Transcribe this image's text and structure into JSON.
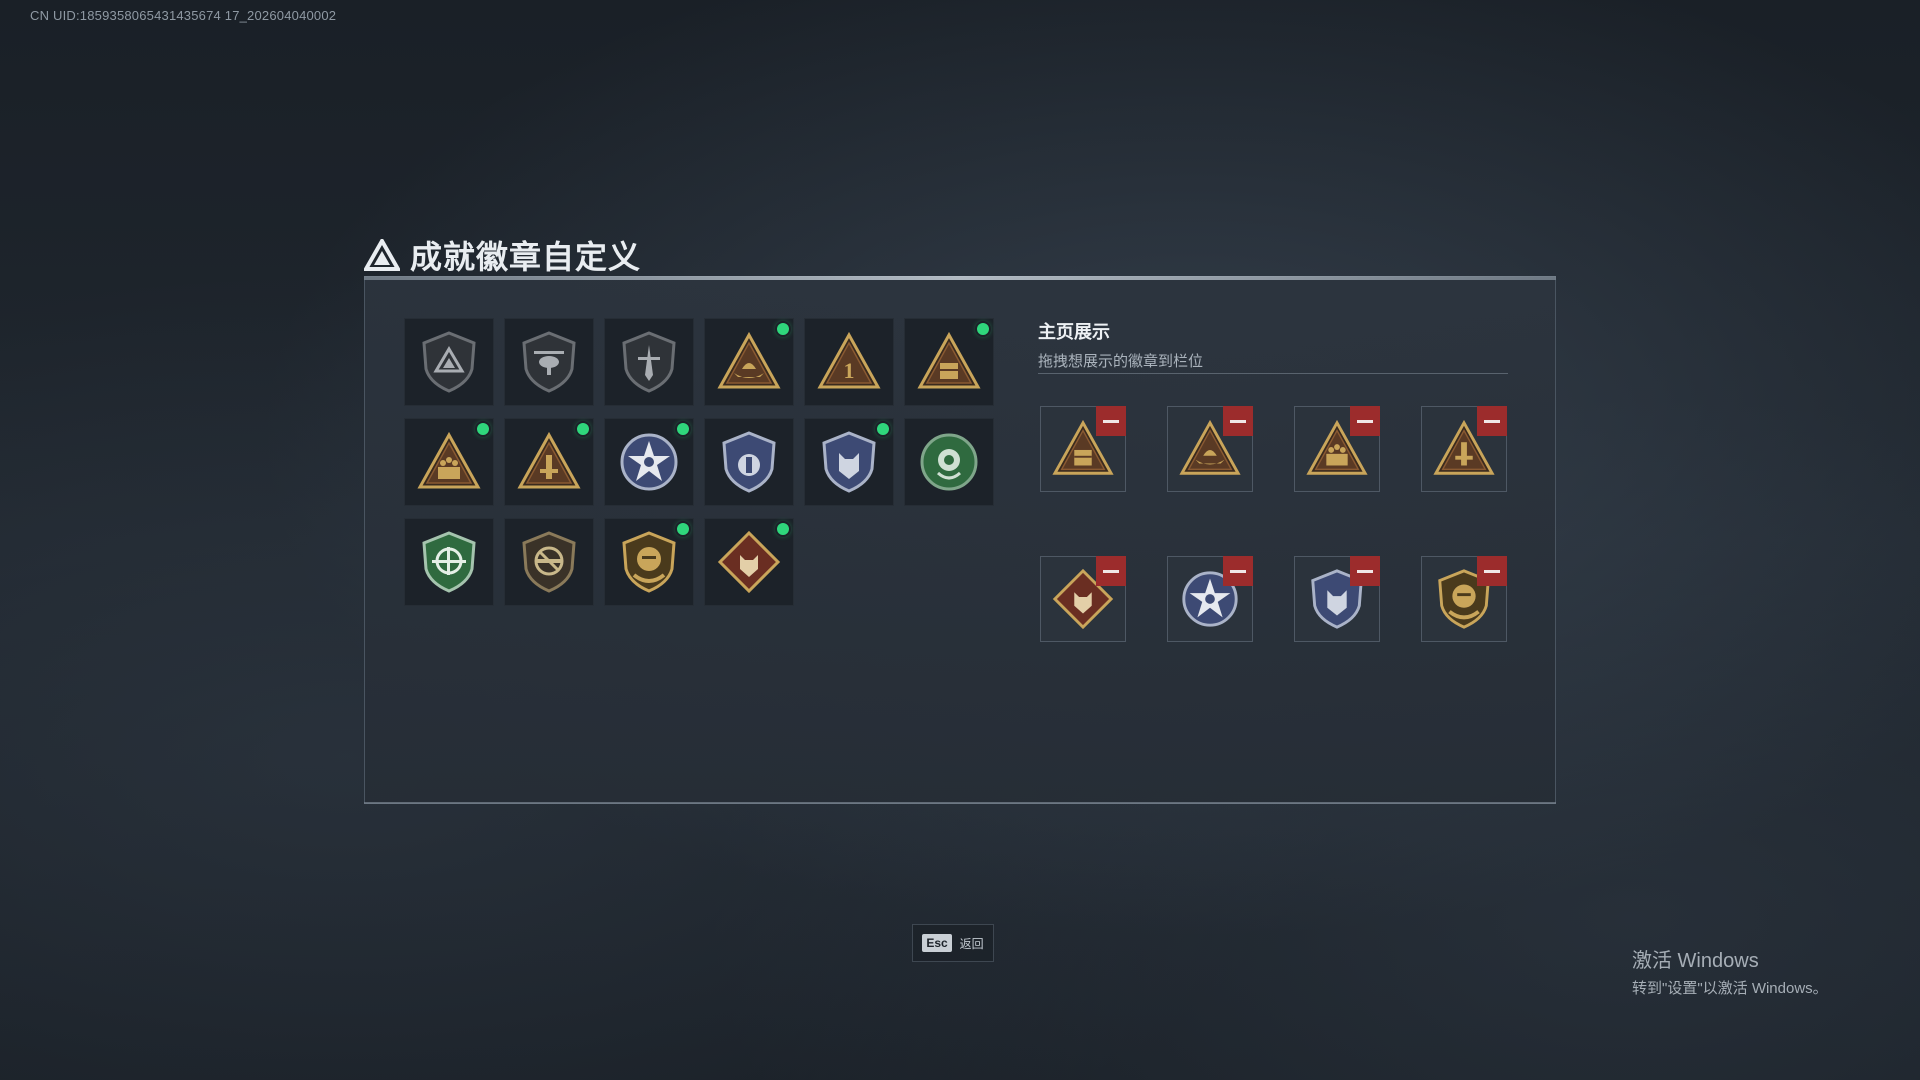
{
  "header": {
    "uid": "CN UID:1859358065431435674 17_202604040002"
  },
  "title": {
    "text": "成就徽章自定义"
  },
  "grid": {
    "badges": [
      {
        "icon": "triangle-shield-badge-icon",
        "new": false
      },
      {
        "icon": "helicopter-shield-badge-icon",
        "new": false
      },
      {
        "icon": "blade-shield-badge-icon",
        "new": false
      },
      {
        "icon": "boat-triangle-badge-icon",
        "new": true
      },
      {
        "icon": "number-one-triangle-badge-icon",
        "new": false
      },
      {
        "icon": "chest-triangle-badge-icon",
        "new": true
      },
      {
        "icon": "soldiers-triangle-badge-icon",
        "new": true
      },
      {
        "icon": "tower-triangle-badge-icon",
        "new": true
      },
      {
        "icon": "star-emblem-badge-icon",
        "new": true
      },
      {
        "icon": "police-shield-badge-icon",
        "new": false
      },
      {
        "icon": "wolf-shield-badge-icon",
        "new": true
      },
      {
        "icon": "rose-green-badge-icon",
        "new": false
      },
      {
        "icon": "crosshair-rifle-badge-icon",
        "new": false
      },
      {
        "icon": "no-rifle-badge-icon",
        "new": false
      },
      {
        "icon": "gold-emblem-badge-icon",
        "new": true
      },
      {
        "icon": "wolf-diamond-badge-icon",
        "new": true
      }
    ]
  },
  "display": {
    "title": "主页展示",
    "subtitle": "拖拽想展示的徽章到栏位",
    "slots": [
      {
        "icon": "chest-triangle-badge-icon"
      },
      {
        "icon": "boat-triangle-badge-icon"
      },
      {
        "icon": "soldiers-triangle-badge-icon"
      },
      {
        "icon": "tower-triangle-badge-icon"
      },
      {
        "icon": "wolf-diamond-badge-icon"
      },
      {
        "icon": "star-emblem-badge-icon"
      },
      {
        "icon": "wolf-shield-badge-icon"
      },
      {
        "icon": "gold-emblem-badge-icon"
      }
    ]
  },
  "footer": {
    "esc_key": "Esc",
    "esc_label": "返回"
  },
  "watermark": {
    "line1": "激活 Windows",
    "line2": "转到\"设置\"以激活 Windows。"
  },
  "colors": {
    "new_dot": "#2fd77c",
    "remove": "#9c2c2c",
    "gold": "#c9a55a",
    "navy": "#3d4a74",
    "green": "#2f6a3f"
  }
}
